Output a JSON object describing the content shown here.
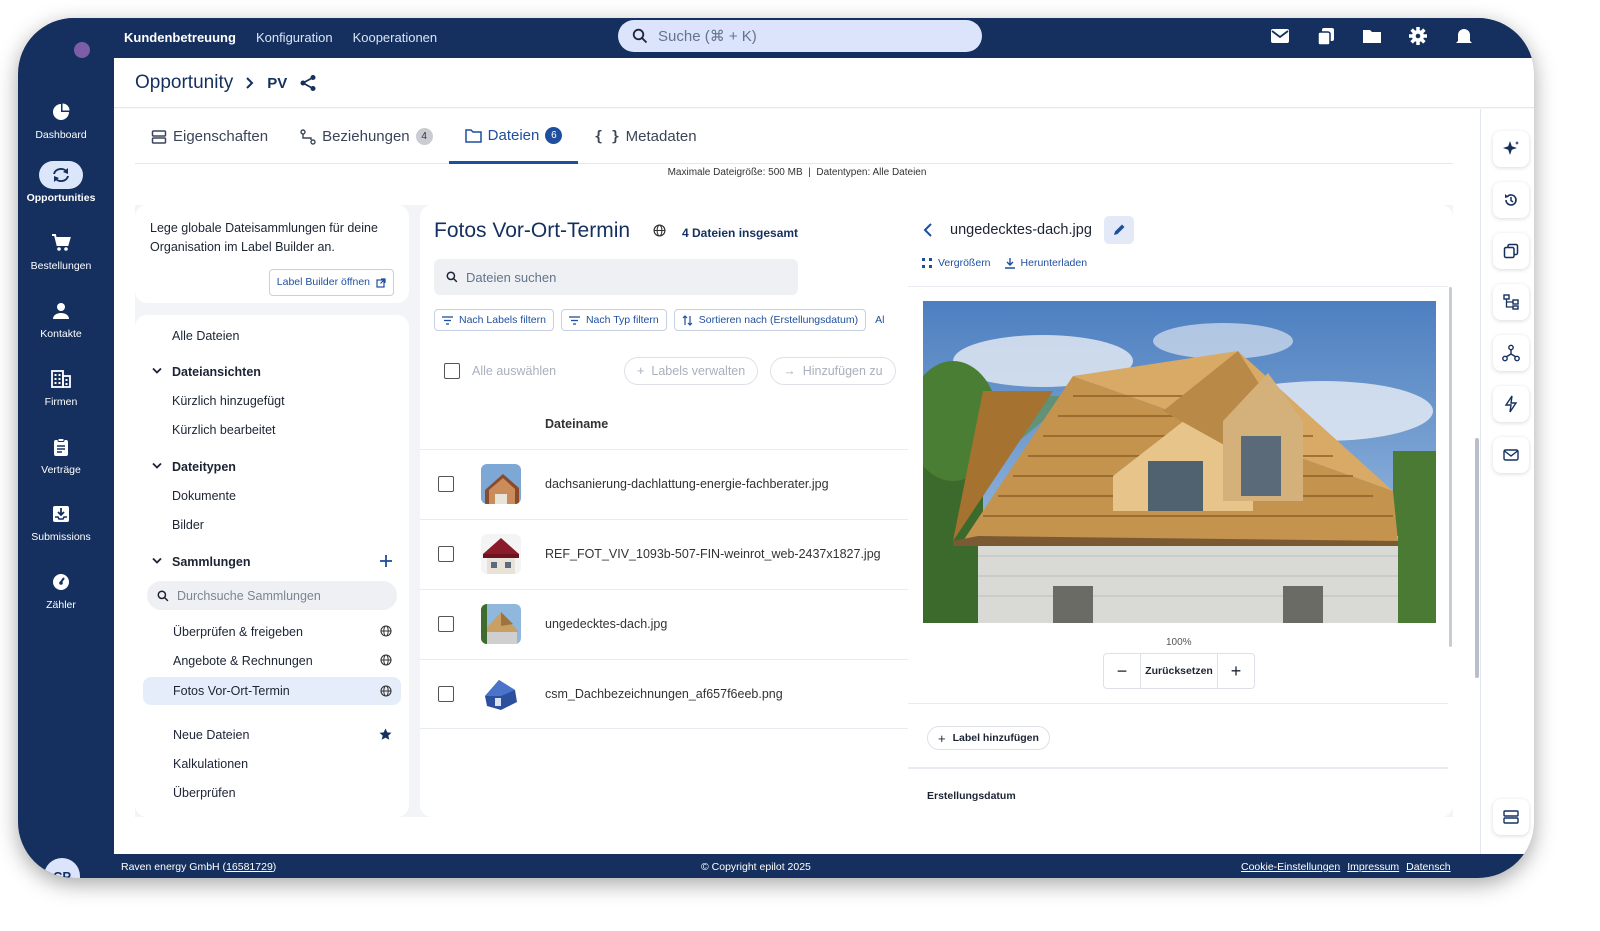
{
  "topbar": {
    "nav": [
      "Kundenbetreuung",
      "Konfiguration",
      "Kooperationen"
    ],
    "search_placeholder": "Suche (⌘ + K)",
    "icons": [
      "mail-icon",
      "copy-icon",
      "folder-icon",
      "gear-icon",
      "bell-icon"
    ]
  },
  "sidebar": {
    "items": [
      {
        "label": "Dashboard",
        "icon": "pie-chart-icon"
      },
      {
        "label": "Opportunities",
        "icon": "sync-icon"
      },
      {
        "label": "Bestellungen",
        "icon": "cart-icon"
      },
      {
        "label": "Kontakte",
        "icon": "person-icon"
      },
      {
        "label": "Firmen",
        "icon": "building-icon"
      },
      {
        "label": "Verträge",
        "icon": "clipboard-icon"
      },
      {
        "label": "Submissions",
        "icon": "inbox-icon"
      },
      {
        "label": "Zähler",
        "icon": "meter-icon"
      }
    ],
    "avatar": "CP"
  },
  "header": {
    "title": "Opportunity",
    "subtitle": "PV"
  },
  "tabs": [
    {
      "label": "Eigenschaften",
      "badge": ""
    },
    {
      "label": "Beziehungen",
      "badge": "4"
    },
    {
      "label": "Dateien",
      "badge": "6"
    },
    {
      "label": "Metadaten",
      "badge": ""
    }
  ],
  "upload_info": "Maximale Dateigröße: 500 MB  |  Datentypen: Alle Dateien",
  "info_card": {
    "text": "Lege globale Dateisammlungen für deine Organisation im Label Builder an.",
    "button": "Label Builder öffnen"
  },
  "tree": {
    "all_files": "Alle Dateien",
    "views_title": "Dateiansichten",
    "views": [
      "Kürzlich hinzugefügt",
      "Kürzlich bearbeitet"
    ],
    "types_title": "Dateitypen",
    "types": [
      "Dokumente",
      "Bilder"
    ],
    "collections_title": "Sammlungen",
    "collections_search_placeholder": "Durchsuche Sammlungen",
    "collections": [
      "Überprüfen & freigeben",
      "Angebote & Rechnungen",
      "Fotos Vor-Ort-Termin"
    ],
    "extra": [
      "Neue Dateien",
      "Kalkulationen",
      "Überprüfen"
    ]
  },
  "files_panel": {
    "title": "Fotos Vor-Ort-Termin",
    "count": "4 Dateien insgesamt",
    "search_placeholder": "Dateien suchen",
    "filters": [
      "Nach Labels filtern",
      "Nach Typ filtern",
      "Sortieren nach (Erstellungsdatum)",
      "Al"
    ],
    "select_all": "Alle auswählen",
    "manage_labels": "Labels verwalten",
    "add_to": "Hinzufügen zu",
    "column_name": "Dateiname",
    "files": [
      {
        "name": "dachsanierung-dachlattung-energie-fachberater.jpg"
      },
      {
        "name": "REF_FOT_VIV_1093b-507-FIN-weinrot_web-2437x1827.jpg"
      },
      {
        "name": "ungedecktes-dach.jpg"
      },
      {
        "name": "csm_Dachbezeichnungen_af657f6eeb.png"
      }
    ]
  },
  "preview": {
    "filename": "ungedecktes-dach.jpg",
    "enlarge": "Vergrößern",
    "download": "Herunterladen",
    "zoom_level": "100%",
    "reset": "Zurücksetzen",
    "add_label": "Label hinzufügen",
    "creation_date_label": "Erstellungsdatum"
  },
  "rail": {
    "icons": [
      "sparkle-icon",
      "history-icon",
      "copy-icon",
      "hierarchy-icon",
      "network-icon",
      "bolt-icon",
      "mail-icon",
      "list-icon"
    ]
  },
  "footer": {
    "company": "Raven energy GmbH",
    "company_id": "16581729",
    "copyright": "© Copyright epilot 2025",
    "links": [
      "Cookie-Einstellungen",
      "Impressum",
      "Datensch"
    ]
  },
  "colors": {
    "brand": "#15305e",
    "accent": "#1e4f9e"
  }
}
